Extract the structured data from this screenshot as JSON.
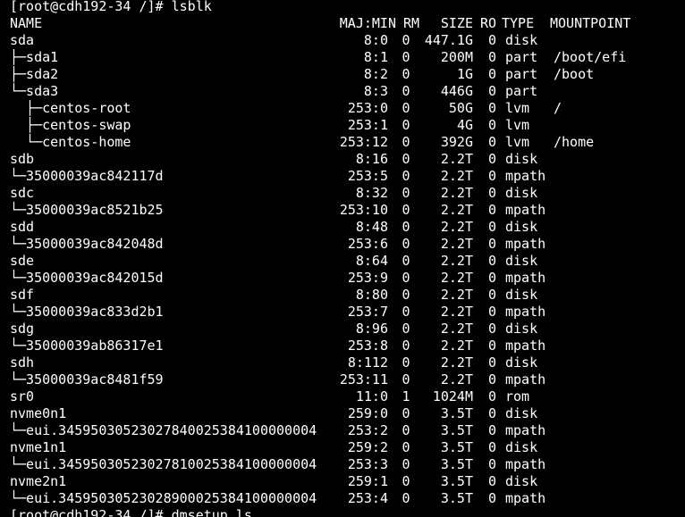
{
  "terminal": {
    "prompt_command": "[root@cdh192-34 /]# lsblk",
    "next_prompt": "[root@cdh192-34 /]# dmsetup ls",
    "header": {
      "name": "NAME",
      "majmin": "MAJ:MIN",
      "rm": "RM",
      "size": "SIZE",
      "ro": "RO",
      "type": "TYPE",
      "mountpoint": "MOUNTPOINT"
    },
    "rows": [
      {
        "name": "sda",
        "majmin": "8:0",
        "rm": "0",
        "size": "447.1G",
        "ro": "0",
        "type": "disk",
        "mountpoint": ""
      },
      {
        "name": "├─sda1",
        "majmin": "8:1",
        "rm": "0",
        "size": "200M",
        "ro": "0",
        "type": "part",
        "mountpoint": "/boot/efi"
      },
      {
        "name": "├─sda2",
        "majmin": "8:2",
        "rm": "0",
        "size": "1G",
        "ro": "0",
        "type": "part",
        "mountpoint": "/boot"
      },
      {
        "name": "└─sda3",
        "majmin": "8:3",
        "rm": "0",
        "size": "446G",
        "ro": "0",
        "type": "part",
        "mountpoint": ""
      },
      {
        "name": "  ├─centos-root",
        "majmin": "253:0",
        "rm": "0",
        "size": "50G",
        "ro": "0",
        "type": "lvm",
        "mountpoint": "/"
      },
      {
        "name": "  ├─centos-swap",
        "majmin": "253:1",
        "rm": "0",
        "size": "4G",
        "ro": "0",
        "type": "lvm",
        "mountpoint": ""
      },
      {
        "name": "  └─centos-home",
        "majmin": "253:12",
        "rm": "0",
        "size": "392G",
        "ro": "0",
        "type": "lvm",
        "mountpoint": "/home"
      },
      {
        "name": "sdb",
        "majmin": "8:16",
        "rm": "0",
        "size": "2.2T",
        "ro": "0",
        "type": "disk",
        "mountpoint": ""
      },
      {
        "name": "└─35000039ac842117d",
        "majmin": "253:5",
        "rm": "0",
        "size": "2.2T",
        "ro": "0",
        "type": "mpath",
        "mountpoint": ""
      },
      {
        "name": "sdc",
        "majmin": "8:32",
        "rm": "0",
        "size": "2.2T",
        "ro": "0",
        "type": "disk",
        "mountpoint": ""
      },
      {
        "name": "└─35000039ac8521b25",
        "majmin": "253:10",
        "rm": "0",
        "size": "2.2T",
        "ro": "0",
        "type": "mpath",
        "mountpoint": ""
      },
      {
        "name": "sdd",
        "majmin": "8:48",
        "rm": "0",
        "size": "2.2T",
        "ro": "0",
        "type": "disk",
        "mountpoint": ""
      },
      {
        "name": "└─35000039ac842048d",
        "majmin": "253:6",
        "rm": "0",
        "size": "2.2T",
        "ro": "0",
        "type": "mpath",
        "mountpoint": ""
      },
      {
        "name": "sde",
        "majmin": "8:64",
        "rm": "0",
        "size": "2.2T",
        "ro": "0",
        "type": "disk",
        "mountpoint": ""
      },
      {
        "name": "└─35000039ac842015d",
        "majmin": "253:9",
        "rm": "0",
        "size": "2.2T",
        "ro": "0",
        "type": "mpath",
        "mountpoint": ""
      },
      {
        "name": "sdf",
        "majmin": "8:80",
        "rm": "0",
        "size": "2.2T",
        "ro": "0",
        "type": "disk",
        "mountpoint": ""
      },
      {
        "name": "└─35000039ac833d2b1",
        "majmin": "253:7",
        "rm": "0",
        "size": "2.2T",
        "ro": "0",
        "type": "mpath",
        "mountpoint": ""
      },
      {
        "name": "sdg",
        "majmin": "8:96",
        "rm": "0",
        "size": "2.2T",
        "ro": "0",
        "type": "disk",
        "mountpoint": ""
      },
      {
        "name": "└─35000039ab86317e1",
        "majmin": "253:8",
        "rm": "0",
        "size": "2.2T",
        "ro": "0",
        "type": "mpath",
        "mountpoint": ""
      },
      {
        "name": "sdh",
        "majmin": "8:112",
        "rm": "0",
        "size": "2.2T",
        "ro": "0",
        "type": "disk",
        "mountpoint": ""
      },
      {
        "name": "└─35000039ac8481f59",
        "majmin": "253:11",
        "rm": "0",
        "size": "2.2T",
        "ro": "0",
        "type": "mpath",
        "mountpoint": ""
      },
      {
        "name": "sr0",
        "majmin": "11:0",
        "rm": "1",
        "size": "1024M",
        "ro": "0",
        "type": "rom",
        "mountpoint": ""
      },
      {
        "name": "nvme0n1",
        "majmin": "259:0",
        "rm": "0",
        "size": "3.5T",
        "ro": "0",
        "type": "disk",
        "mountpoint": ""
      },
      {
        "name": "└─eui.34595030523027840025384100000004",
        "majmin": "253:2",
        "rm": "0",
        "size": "3.5T",
        "ro": "0",
        "type": "mpath",
        "mountpoint": ""
      },
      {
        "name": "nvme1n1",
        "majmin": "259:2",
        "rm": "0",
        "size": "3.5T",
        "ro": "0",
        "type": "disk",
        "mountpoint": ""
      },
      {
        "name": "└─eui.34595030523027810025384100000004",
        "majmin": "253:3",
        "rm": "0",
        "size": "3.5T",
        "ro": "0",
        "type": "mpath",
        "mountpoint": ""
      },
      {
        "name": "nvme2n1",
        "majmin": "259:1",
        "rm": "0",
        "size": "3.5T",
        "ro": "0",
        "type": "disk",
        "mountpoint": ""
      },
      {
        "name": "└─eui.34595030523028900025384100000004",
        "majmin": "253:4",
        "rm": "0",
        "size": "3.5T",
        "ro": "0",
        "type": "mpath",
        "mountpoint": ""
      }
    ]
  }
}
